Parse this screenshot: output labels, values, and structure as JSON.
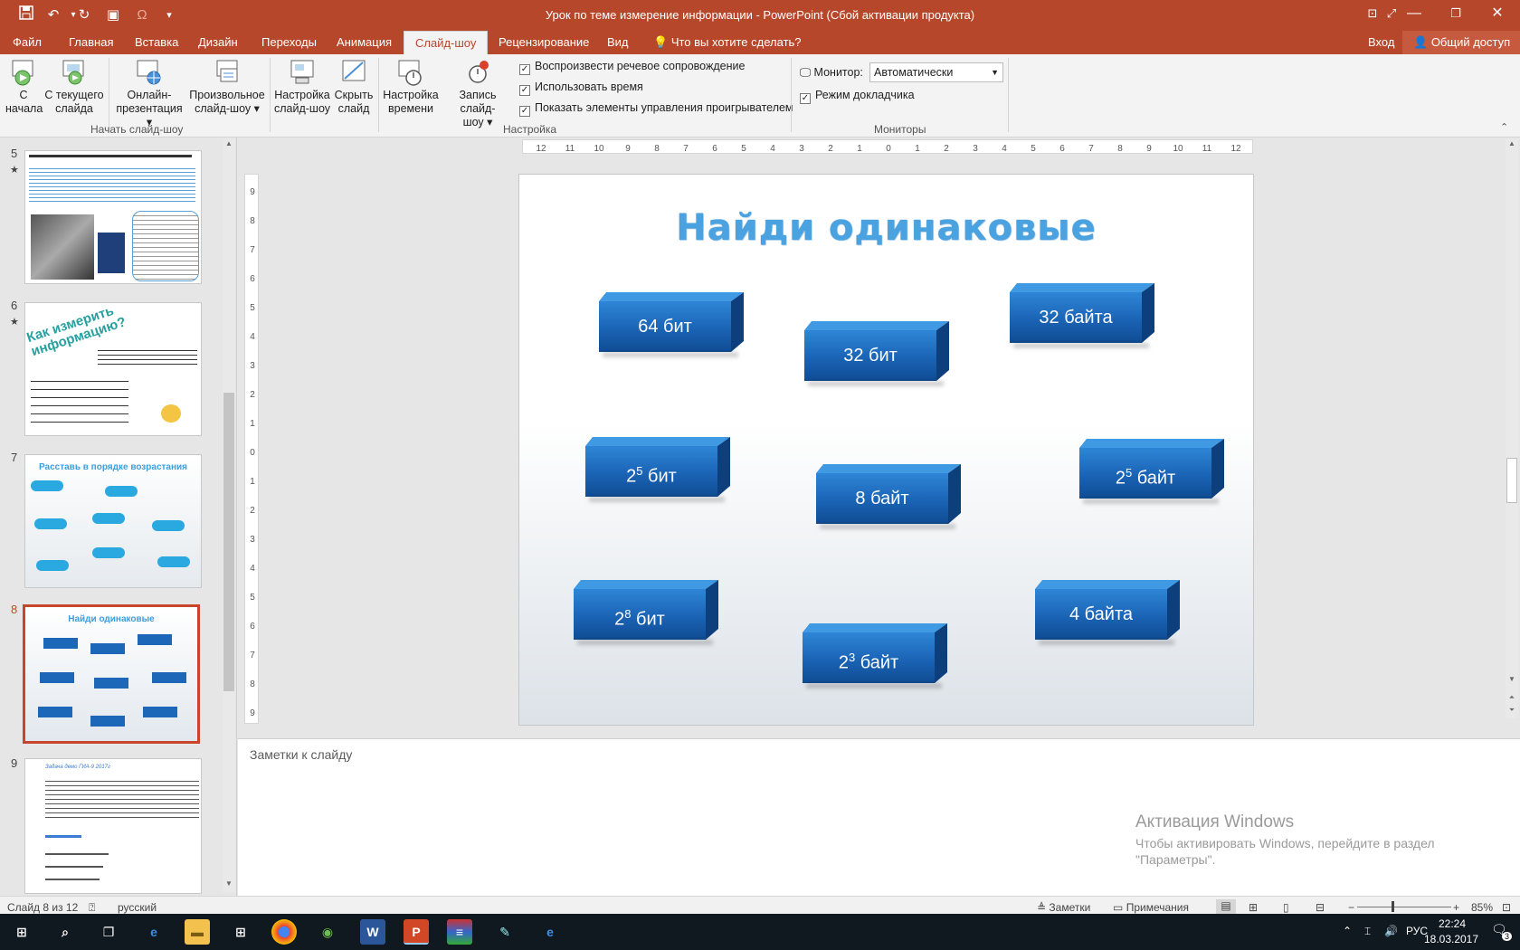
{
  "window": {
    "title": "Урок по теме измерение информации - PowerPoint (Сбой активации продукта)"
  },
  "tabs": [
    {
      "label": "Файл"
    },
    {
      "label": "Главная"
    },
    {
      "label": "Вставка"
    },
    {
      "label": "Дизайн"
    },
    {
      "label": "Переходы"
    },
    {
      "label": "Анимация"
    },
    {
      "label": "Слайд-шоу"
    },
    {
      "label": "Рецензирование"
    },
    {
      "label": "Вид"
    },
    {
      "label": "Что вы хотите сделать?"
    }
  ],
  "account": {
    "signin": "Вход",
    "share": "Общий доступ"
  },
  "ribbon": {
    "start_group": "Начать слайд-шоу",
    "setup_group": "Настройка",
    "monitors_group": "Мониторы",
    "btn_from_start": [
      "С",
      "начала"
    ],
    "btn_from_current": [
      "С текущего",
      "слайда"
    ],
    "btn_online": [
      "Онлайн-",
      "презентация"
    ],
    "btn_custom": [
      "Произвольное",
      "слайд-шоу"
    ],
    "btn_setup": [
      "Настройка",
      "слайд-шоу"
    ],
    "btn_hide": [
      "Скрыть",
      "слайд"
    ],
    "btn_timings": [
      "Настройка",
      "времени"
    ],
    "btn_record": [
      "Запись слайд-",
      "шоу"
    ],
    "chk_narration": "Воспроизвести речевое сопровождение",
    "chk_timings": "Использовать время",
    "chk_controls": "Показать элементы управления проигрывателем",
    "monitor_label": "Монитор:",
    "monitor_value": "Автоматически",
    "presenter_view": "Режим докладчика"
  },
  "thumbnails": [
    {
      "num": "5",
      "star": "★"
    },
    {
      "num": "6",
      "star": "★",
      "title": "Как измерить информацию?"
    },
    {
      "num": "7",
      "title": "Расставь в порядке возрастания"
    },
    {
      "num": "8",
      "title": "Найди одинаковые"
    },
    {
      "num": "9",
      "title": "Задача демо ГИА-9 2017г"
    }
  ],
  "slide": {
    "title": "Найди одинаковые",
    "blocks": [
      {
        "text": "64 бит"
      },
      {
        "text": "32 бит"
      },
      {
        "text": "32 байта"
      },
      {
        "base": "2",
        "exp": "5",
        "unit": " бит"
      },
      {
        "text": "8 байт"
      },
      {
        "base": "2",
        "exp": "5",
        "unit": " байт"
      },
      {
        "base": "2",
        "exp": "8",
        "unit": " бит"
      },
      {
        "base": "2",
        "exp": "3",
        "unit": " байт"
      },
      {
        "text": "4 байта"
      }
    ]
  },
  "notes": {
    "placeholder": "Заметки к слайду"
  },
  "activation": {
    "title": "Активация Windows",
    "line1": "Чтобы активировать Windows, перейдите в раздел",
    "line2": "\"Параметры\"."
  },
  "status": {
    "slide": "Слайд 8 из 12",
    "language": "русский",
    "notes": "Заметки",
    "comments": "Примечания",
    "zoom": "85%"
  },
  "taskbar": {
    "time": "22:24",
    "date": "18.03.2017",
    "lang": "РУС",
    "notif_count": "3"
  }
}
